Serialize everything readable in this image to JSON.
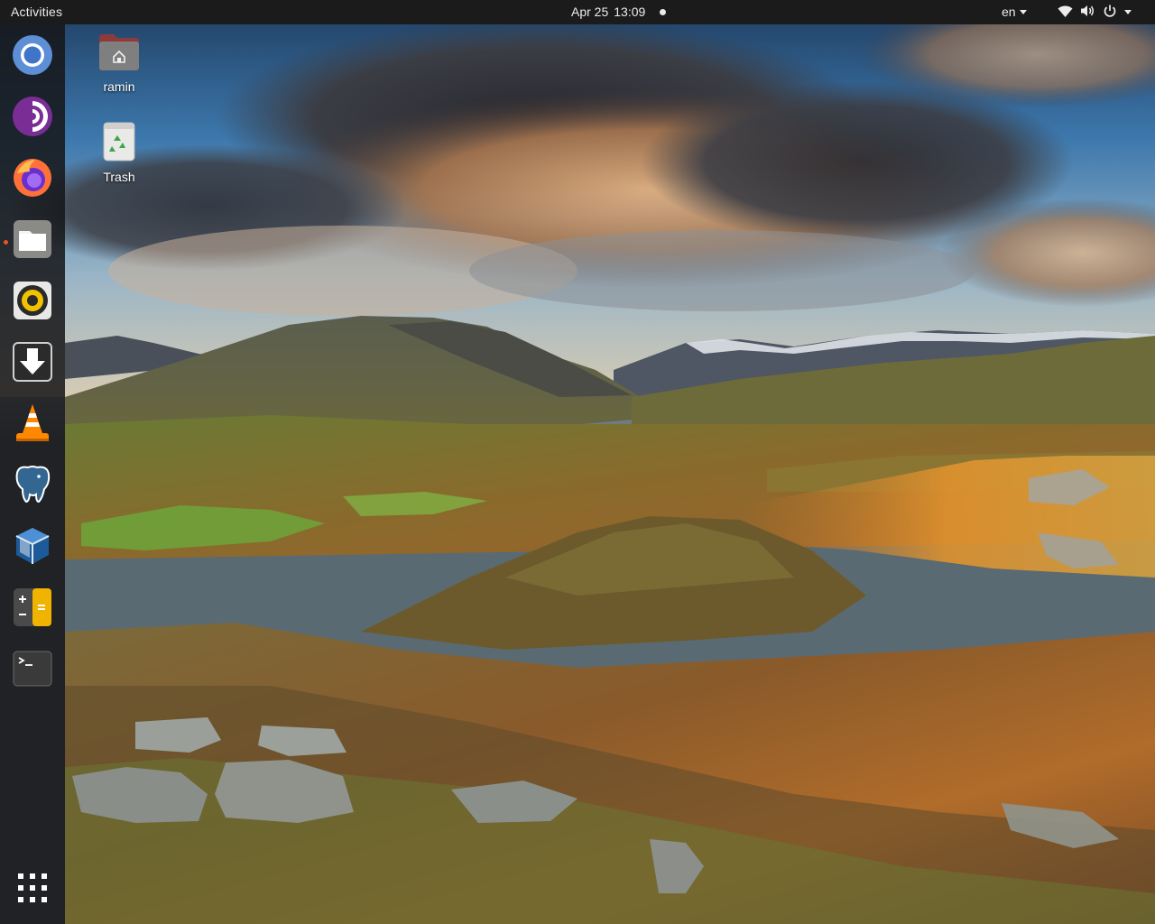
{
  "topbar": {
    "activities_label": "Activities",
    "date": "Apr 25",
    "time": "13:09",
    "language": "en",
    "tray_icons": [
      "network-wifi-icon",
      "volume-icon",
      "power-icon",
      "chevron-down-icon"
    ]
  },
  "dock": {
    "items": [
      {
        "name": "chromium",
        "icon": "chromium-icon"
      },
      {
        "name": "tor-browser",
        "icon": "tor-browser-icon"
      },
      {
        "name": "firefox",
        "icon": "firefox-icon"
      },
      {
        "name": "files",
        "icon": "files-icon",
        "running": true
      },
      {
        "name": "rhythmbox",
        "icon": "rhythmbox-icon"
      },
      {
        "name": "software-updater",
        "icon": "download-icon"
      },
      {
        "name": "vlc",
        "icon": "vlc-icon"
      },
      {
        "name": "pgadmin",
        "icon": "postgresql-elephant-icon"
      },
      {
        "name": "virtualbox",
        "icon": "virtualbox-icon"
      },
      {
        "name": "calculator",
        "icon": "calculator-icon"
      },
      {
        "name": "terminal",
        "icon": "terminal-icon"
      }
    ],
    "show_apps_icon": "app-grid-icon"
  },
  "desktop": {
    "icons": [
      {
        "label": "ramin",
        "icon": "home-folder-icon"
      },
      {
        "label": "Trash",
        "icon": "trash-icon"
      }
    ]
  },
  "colors": {
    "topbar_bg": "#1b1b1b",
    "dock_bg": "#161618",
    "accent_running": "#e95420"
  }
}
